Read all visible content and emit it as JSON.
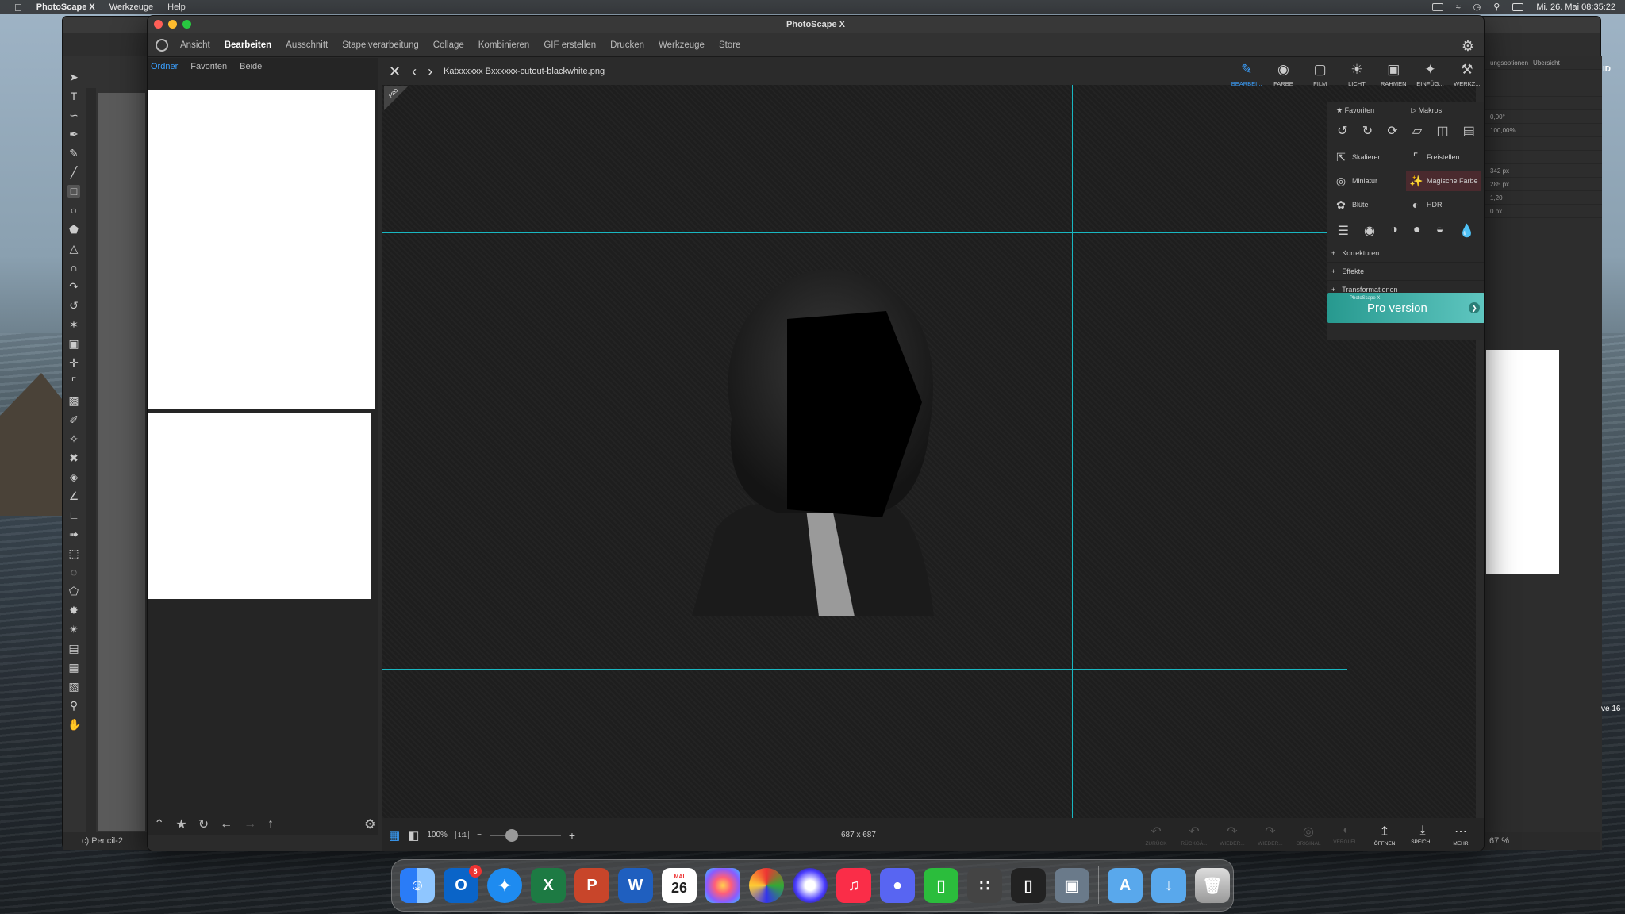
{
  "menubar": {
    "app": "PhotoScape X",
    "items": [
      "Werkzeuge",
      "Help"
    ],
    "datetime": "Mi. 26. Mai 08:35:22"
  },
  "bgapp": {
    "layer_label": "c) Pencil-2",
    "zoom": "67 %",
    "panel_tab1": "ungsoptionen",
    "panel_tab2": "Übersicht",
    "angle": "0,00°",
    "pct": "100,00%",
    "w": "342 px",
    "h": "285 px",
    "ratio": "1,20",
    "off": "0 px",
    "side_text1": "ID",
    "side_text2": "ve 16"
  },
  "window": {
    "title": "PhotoScape X"
  },
  "nav": {
    "tabs": [
      "Ansicht",
      "Bearbeiten",
      "Ausschnitt",
      "Stapelverarbeitung",
      "Collage",
      "Kombinieren",
      "GIF erstellen",
      "Drucken",
      "Werkzeuge",
      "Store"
    ],
    "active": "Bearbeiten"
  },
  "left": {
    "tabs": [
      "Ordner",
      "Favoriten",
      "Beide"
    ],
    "active": "Ordner"
  },
  "canvas": {
    "filename": "Katxxxxxx Bxxxxxx-cutout-blackwhite.png",
    "badge": "PRO"
  },
  "toolbar_right": [
    {
      "label": "BEARBEI...",
      "icon": "edit-icon"
    },
    {
      "label": "FARBE",
      "icon": "color-icon"
    },
    {
      "label": "FILM",
      "icon": "film-icon"
    },
    {
      "label": "LICHT",
      "icon": "light-icon"
    },
    {
      "label": "RAHMEN",
      "icon": "frame-icon"
    },
    {
      "label": "EINFÜG...",
      "icon": "insert-icon"
    },
    {
      "label": "WERKZ...",
      "icon": "tools-icon"
    }
  ],
  "panel": {
    "favoriten": "Favoriten",
    "makros": "Makros",
    "grid": [
      {
        "label": "Skalieren",
        "icon": "resize-icon"
      },
      {
        "label": "Freistellen",
        "icon": "crop-icon"
      },
      {
        "label": "Miniatur",
        "icon": "miniature-icon"
      },
      {
        "label": "Magische Farbe",
        "icon": "magic-color-icon"
      },
      {
        "label": "Blüte",
        "icon": "bloom-icon"
      },
      {
        "label": "HDR",
        "icon": "hdr-icon"
      }
    ],
    "sections": [
      "Korrekturen",
      "Effekte",
      "Transformationen"
    ],
    "pro_small": "PhotoScape X",
    "pro_text": "Pro version"
  },
  "bottom": {
    "zoom": "100%",
    "ratio": "1:1",
    "size": "687 x 687",
    "actions": [
      {
        "label": "ZURÜCK",
        "enabled": false
      },
      {
        "label": "RÜCKGÄ...",
        "enabled": false
      },
      {
        "label": "WIEDER...",
        "enabled": false
      },
      {
        "label": "WIEDER...",
        "enabled": false
      },
      {
        "label": "ORIGINAL",
        "enabled": false
      },
      {
        "label": "VERGLEI...",
        "enabled": false
      },
      {
        "label": "ÖFFNEN",
        "enabled": true
      },
      {
        "label": "SPEICH...",
        "enabled": true
      },
      {
        "label": "MEHR",
        "enabled": true
      }
    ]
  },
  "dock": {
    "outlook_badge": "8",
    "calendar_month": "MAI",
    "calendar_day": "26"
  }
}
